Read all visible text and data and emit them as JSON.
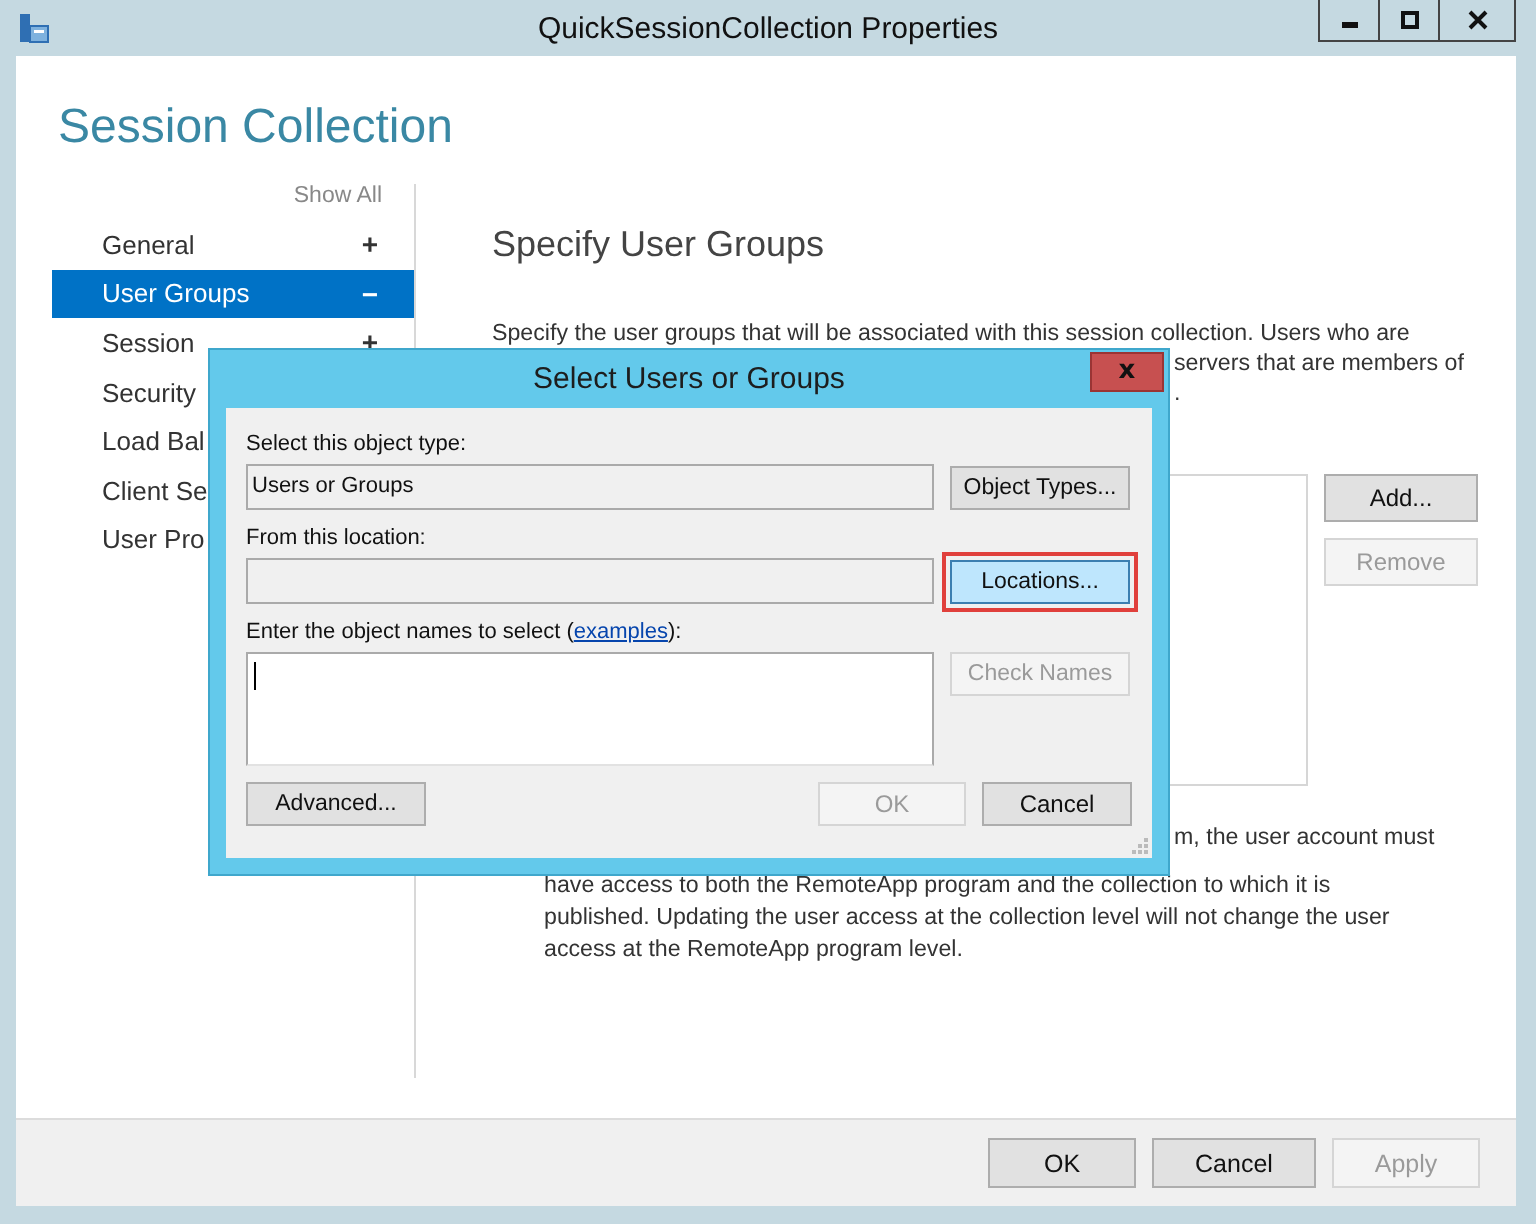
{
  "window": {
    "title": "QuickSessionCollection Properties"
  },
  "heading": "Session Collection",
  "sidebar": {
    "show_all": "Show All",
    "items": [
      {
        "label": "General",
        "sign": "+",
        "selected": false
      },
      {
        "label": "User Groups",
        "sign": "−",
        "selected": true
      },
      {
        "label": "Session",
        "sign": "+",
        "selected": false
      },
      {
        "label": "Security",
        "selected": false
      },
      {
        "label": "Load Bal",
        "selected": false
      },
      {
        "label": "Client Se",
        "selected": false
      },
      {
        "label": "User Pro",
        "selected": false
      }
    ]
  },
  "page": {
    "title": "Specify User Groups",
    "intro": "Specify the user groups that will be associated with this session collection. Users who are",
    "intro_fragments": [
      "servers that are members of",
      "."
    ],
    "note_fragment": "m, the user account must",
    "note_lines": [
      "have access to both the RemoteApp program and the collection to which it is",
      "published. Updating the user access at the collection level will not change the user",
      "access at the RemoteApp program level."
    ],
    "buttons": [
      {
        "label": "Add...",
        "disabled": false
      },
      {
        "label": "Remove",
        "disabled": true
      }
    ]
  },
  "dialog": {
    "title": "Select Users or Groups",
    "close": "x",
    "type_label": "Select this object type:",
    "type_value": "Users or Groups",
    "type_button": "Object Types...",
    "location_label": "From this location:",
    "location_button": "Locations...",
    "location_highlighted": true,
    "names_label": {
      "before": "Enter the object names to select (",
      "link": "examples",
      "after": "):"
    },
    "check_button": {
      "label": "Check Names",
      "disabled": true
    },
    "advanced_button": "Advanced...",
    "buttons": [
      {
        "label": "OK",
        "disabled": true
      },
      {
        "label": "Cancel",
        "disabled": false
      }
    ]
  },
  "footer_buttons": [
    {
      "label": "OK",
      "disabled": false
    },
    {
      "label": "Cancel",
      "disabled": false
    },
    {
      "label": "Apply",
      "disabled": true
    }
  ]
}
